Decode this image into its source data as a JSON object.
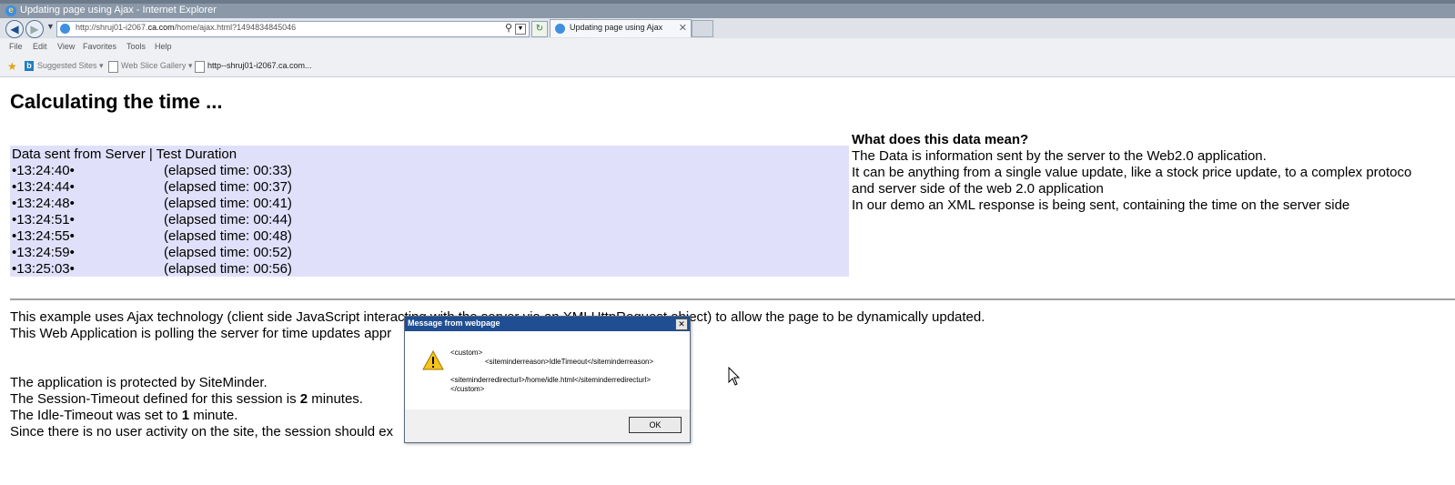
{
  "window": {
    "title": "Updating page using Ajax - Internet Explorer"
  },
  "address": {
    "url_prefix": "http://shruj01-i2067.",
    "url_domain": "ca.com",
    "url_suffix": "/home/ajax.html?1494834845046"
  },
  "tab": {
    "label": "Updating page using Ajax"
  },
  "menu": [
    "File",
    "Edit",
    "View",
    "Favorites",
    "Tools",
    "Help"
  ],
  "favorites": {
    "suggested": "Suggested Sites ▾",
    "webslice": "Web Slice Gallery ▾",
    "link": "http--shruj01-i2067.ca.com..."
  },
  "page": {
    "heading": "Calculating the time ...",
    "table_header": "Data sent from Server | Test Duration",
    "rows": [
      {
        "time": "•13:24:40•",
        "elapsed": "(elapsed time: 00:33)"
      },
      {
        "time": "•13:24:44•",
        "elapsed": "(elapsed time: 00:37)"
      },
      {
        "time": "•13:24:48•",
        "elapsed": "(elapsed time: 00:41)"
      },
      {
        "time": "•13:24:51•",
        "elapsed": "(elapsed time: 00:44)"
      },
      {
        "time": "•13:24:55•",
        "elapsed": "(elapsed time: 00:48)"
      },
      {
        "time": "•13:24:59•",
        "elapsed": "(elapsed time: 00:52)"
      },
      {
        "time": "•13:25:03•",
        "elapsed": "(elapsed time: 00:56)"
      }
    ],
    "info": {
      "question": "What does this data mean?",
      "line1": "The Data is information sent by the server to the Web2.0 application.",
      "line2": "It can be anything from a single value update, like a stock price update, to a complex protoco",
      "line3": "and server side of the web 2.0 application",
      "line4": "In our demo an XML response is being sent, containing the time on the server side"
    },
    "lines": {
      "l1": "This example uses Ajax technology (client side JavaScript interacting with the server via an XMLHttpRequest object) to allow the page to be dynamically updated.",
      "l2": "This Web Application is polling the server for time updates appr",
      "l3": "The application is protected by SiteMinder.",
      "l4a": "The Session-Timeout defined for this session is ",
      "l4b": "2",
      "l4c": " minutes.",
      "l5a": "The Idle-Timeout was set to ",
      "l5b": "1",
      "l5c": " minute.",
      "l6": "Since there is no user activity on the site, the session should ex"
    }
  },
  "dialog": {
    "title": "Message from webpage",
    "close": "✕",
    "msg1": "<custom>",
    "msg2": "<siteminderreason>IdleTimeout</siteminderreason>",
    "msg3": "<siteminderredirecturl>/home/idle.html</siteminderredirecturl>",
    "msg4": "</custom>",
    "ok": "OK"
  }
}
